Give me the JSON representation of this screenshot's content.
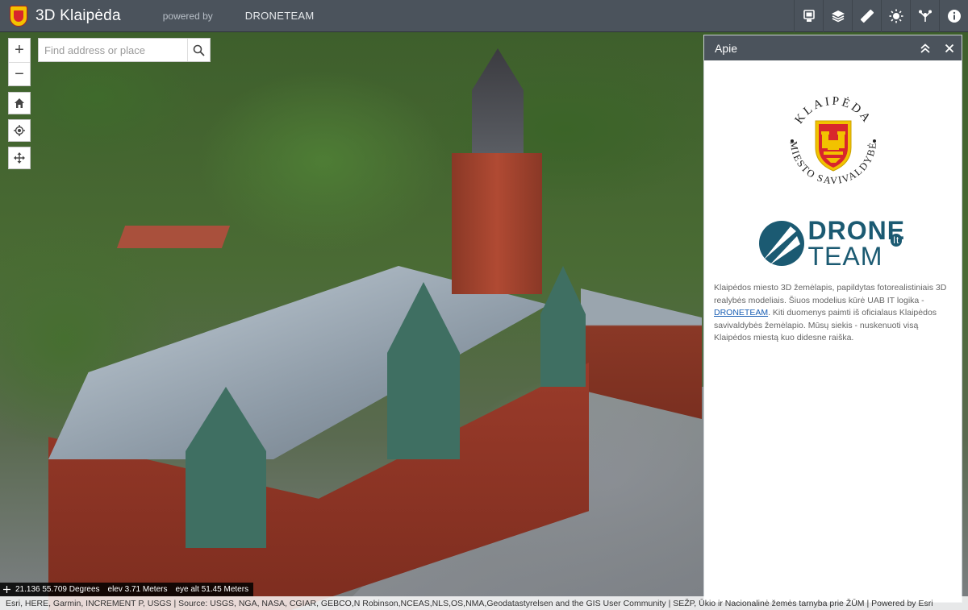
{
  "header": {
    "title": "3D Klaipėda",
    "powered_by": "powered by",
    "brand": "DRONETEAM",
    "tools": [
      {
        "name": "legend-icon"
      },
      {
        "name": "layers-icon"
      },
      {
        "name": "measure-icon"
      },
      {
        "name": "daylight-icon"
      },
      {
        "name": "share-icon"
      },
      {
        "name": "info-icon"
      }
    ]
  },
  "map": {
    "zoom_in": "+",
    "zoom_out": "−",
    "search_placeholder": "Find address or place"
  },
  "panel": {
    "title": "Apie",
    "collapse": "︽",
    "close": "✕",
    "seal_top_text": "KLAIPĖDA",
    "seal_bottom_text": "MIESTO SAVIVALDYBĖ",
    "drone_line1": "DRONE",
    "drone_line2": "TEAM",
    "drone_lt": "lt",
    "about_part1": "Klaipėdos miesto 3D žemėlapis, papildytas fotorealistiniais 3D realybės modeliais. Šiuos modelius kūrė UAB IT logika -",
    "about_link": "DRONETEAM",
    "about_part2": ". Kiti duomenys paimti iš oficialaus Klaipėdos savivaldybės žemėlapio. Mūsų siekis - nuskenuoti visą Klaipėdos miestą kuo didesne raiška."
  },
  "status": {
    "coordinates": "21.136 55.709 Degrees",
    "elevation": "elev 3.71 Meters",
    "eye_alt": "eye alt 51.45 Meters"
  },
  "attribution": "Esri, HERE, Garmin, INCREMENT P, USGS | Source: USGS, NGA, NASA, CGIAR, GEBCO,N Robinson,NCEAS,NLS,OS,NMA,Geodatastyrelsen and the GIS User Community | SEŽP, Ūkio ir Nacionalinė žemės tarnyba prie ŽŪM | Powered by Esri",
  "colors": {
    "header_bg": "#4b535c",
    "link": "#1a5fb4",
    "drone_brand": "#1b5a72",
    "seal_red": "#d8262c",
    "seal_gold": "#f2c200"
  }
}
